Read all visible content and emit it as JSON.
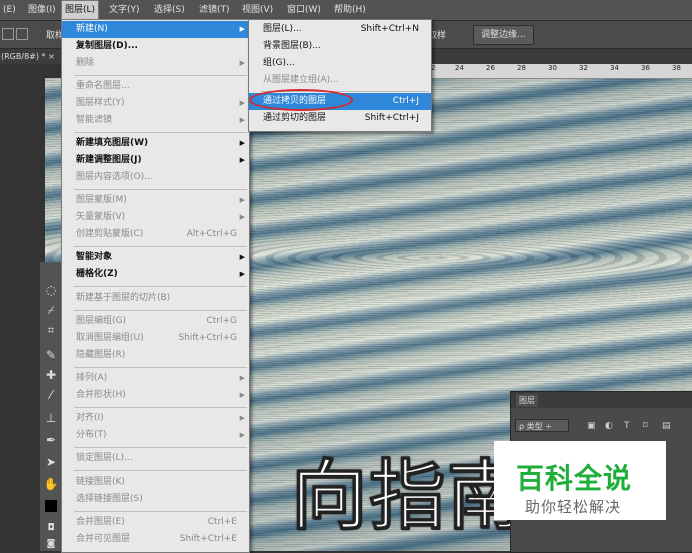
{
  "menubar": {
    "items": [
      "(E)",
      "图像(I)",
      "图层(L)",
      "文字(Y)",
      "选择(S)",
      "滤镜(T)",
      "视图(V)",
      "窗口(W)",
      "帮助(H)"
    ]
  },
  "options": {
    "sample_label": "取样",
    "sample_all": "取样",
    "refine_edge": "调整边缘..."
  },
  "document": {
    "tab": "(RGB/8#) * ×"
  },
  "ruler": [
    "2",
    "24",
    "26",
    "28",
    "30",
    "32",
    "34",
    "36",
    "38"
  ],
  "layer_menu": [
    {
      "label": "新建(N)",
      "shortcut": "",
      "submenu": true,
      "state": "highlight"
    },
    {
      "label": "复制图层(D)...",
      "shortcut": "",
      "submenu": false,
      "state": "bold"
    },
    {
      "label": "删除",
      "shortcut": "",
      "submenu": true,
      "state": "disabled"
    },
    {
      "sep": true
    },
    {
      "label": "重命名图层...",
      "shortcut": "",
      "submenu": false,
      "state": "disabled"
    },
    {
      "label": "图层样式(Y)",
      "shortcut": "",
      "submenu": true,
      "state": "disabled"
    },
    {
      "label": "智能滤镜",
      "shortcut": "",
      "submenu": true,
      "state": "disabled"
    },
    {
      "sep": true
    },
    {
      "label": "新建填充图层(W)",
      "shortcut": "",
      "submenu": true,
      "state": "bold"
    },
    {
      "label": "新建调整图层(J)",
      "shortcut": "",
      "submenu": true,
      "state": "bold"
    },
    {
      "label": "图层内容选项(O)...",
      "shortcut": "",
      "submenu": false,
      "state": "disabled"
    },
    {
      "sep": true
    },
    {
      "label": "图层蒙版(M)",
      "shortcut": "",
      "submenu": true,
      "state": "disabled"
    },
    {
      "label": "矢量蒙版(V)",
      "shortcut": "",
      "submenu": true,
      "state": "disabled"
    },
    {
      "label": "创建剪贴蒙版(C)",
      "shortcut": "Alt+Ctrl+G",
      "submenu": false,
      "state": "disabled"
    },
    {
      "sep": true
    },
    {
      "label": "智能对象",
      "shortcut": "",
      "submenu": true,
      "state": "bold"
    },
    {
      "label": "栅格化(Z)",
      "shortcut": "",
      "submenu": true,
      "state": "bold"
    },
    {
      "sep": true
    },
    {
      "label": "新建基于图层的切片(B)",
      "shortcut": "",
      "submenu": false,
      "state": "disabled"
    },
    {
      "sep": true
    },
    {
      "label": "图层编组(G)",
      "shortcut": "Ctrl+G",
      "submenu": false,
      "state": "disabled"
    },
    {
      "label": "取消图层编组(U)",
      "shortcut": "Shift+Ctrl+G",
      "submenu": false,
      "state": "disabled"
    },
    {
      "label": "隐藏图层(R)",
      "shortcut": "",
      "submenu": false,
      "state": "disabled"
    },
    {
      "sep": true
    },
    {
      "label": "排列(A)",
      "shortcut": "",
      "submenu": true,
      "state": "disabled"
    },
    {
      "label": "合并形状(H)",
      "shortcut": "",
      "submenu": true,
      "state": "disabled"
    },
    {
      "sep": true
    },
    {
      "label": "对齐(I)",
      "shortcut": "",
      "submenu": true,
      "state": "disabled"
    },
    {
      "label": "分布(T)",
      "shortcut": "",
      "submenu": true,
      "state": "disabled"
    },
    {
      "sep": true
    },
    {
      "label": "锁定图层(L)...",
      "shortcut": "",
      "submenu": false,
      "state": "disabled"
    },
    {
      "sep": true
    },
    {
      "label": "链接图层(K)",
      "shortcut": "",
      "submenu": false,
      "state": "disabled"
    },
    {
      "label": "选择链接图层(S)",
      "shortcut": "",
      "submenu": false,
      "state": "disabled"
    },
    {
      "sep": true
    },
    {
      "label": "合并图层(E)",
      "shortcut": "Ctrl+E",
      "submenu": false,
      "state": "disabled"
    },
    {
      "label": "合并可见图层",
      "shortcut": "Shift+Ctrl+E",
      "submenu": false,
      "state": "disabled"
    }
  ],
  "new_submenu": [
    {
      "label": "图层(L)...",
      "shortcut": "Shift+Ctrl+N",
      "state": "normal"
    },
    {
      "label": "背景图层(B)...",
      "shortcut": "",
      "state": "normal"
    },
    {
      "label": "组(G)...",
      "shortcut": "",
      "state": "normal"
    },
    {
      "label": "从图层建立组(A)...",
      "shortcut": "",
      "state": "disabled"
    },
    {
      "sep": true
    },
    {
      "label": "通过拷贝的图层",
      "shortcut": "Ctrl+J",
      "state": "highlight"
    },
    {
      "label": "通过剪切的图层",
      "shortcut": "Shift+Ctrl+J",
      "state": "normal"
    }
  ],
  "canvas": {
    "overlay_text": "向指南"
  },
  "layers_panel": {
    "title": "图层",
    "filter": "ρ 类型 ÷"
  },
  "watermark": {
    "title": "百科全说",
    "subtitle": "助你轻松解决"
  },
  "colors": {
    "highlight": "#2e87d8",
    "oval": "#d8262a",
    "logo_green": "#1fae3a"
  }
}
